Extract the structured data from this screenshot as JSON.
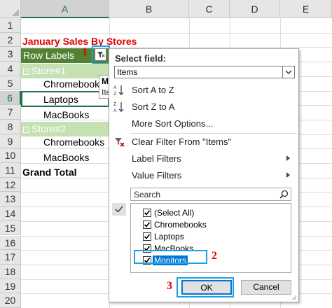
{
  "sheet": {
    "columns": [
      "A",
      "B",
      "C",
      "D",
      "E"
    ],
    "selected_column": "A",
    "rows": [
      "1",
      "2",
      "3",
      "4",
      "5",
      "6",
      "7",
      "8",
      "9",
      "10",
      "11",
      "12",
      "13",
      "14",
      "15",
      "16",
      "17",
      "18",
      "19",
      "20"
    ],
    "selected_row": "6",
    "title": "January Sales By Stores",
    "row_labels": "Row Labels",
    "store1": "Store#1",
    "store1_items": [
      "Chromebooks",
      "Laptops",
      "MacBooks"
    ],
    "store2": "Store#2",
    "store2_items": [
      "Chromebooks",
      "MacBooks"
    ],
    "grand_total": "Grand Total",
    "tooltip_title": "Mi",
    "tooltip_body": "Ite"
  },
  "callouts": {
    "step1": "1",
    "step2": "2",
    "step3": "3"
  },
  "panel": {
    "select_field_label": "Select field:",
    "select_field_value": "Items",
    "sort_az": "Sort A to Z",
    "sort_za": "Sort Z to A",
    "more_sort": "More Sort Options...",
    "clear_filter": "Clear Filter From \"Items\"",
    "label_filters": "Label Filters",
    "value_filters": "Value Filters",
    "search_placeholder": "Search",
    "list": [
      {
        "label": "(Select All)",
        "checked": true
      },
      {
        "label": "Chromebooks",
        "checked": true
      },
      {
        "label": "Laptops",
        "checked": true
      },
      {
        "label": "MacBooks",
        "checked": true
      },
      {
        "label": "Monitors",
        "checked": true,
        "selected": true
      }
    ],
    "ok": "OK",
    "cancel": "Cancel"
  },
  "colors": {
    "pivot_header": "#548235",
    "pivot_group": "#c5e0b3",
    "callout": "#1fa0e6",
    "step_number": "#e00000",
    "selection": "#0078d7"
  }
}
